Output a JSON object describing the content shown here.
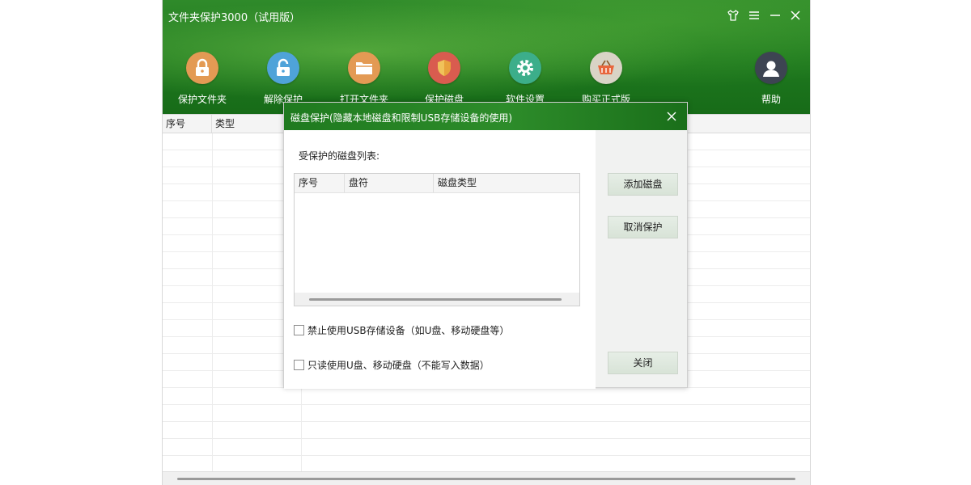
{
  "app": {
    "title": "文件夹保护3000（试用版）",
    "colors": {
      "header_green": "#1f7a1f",
      "accent_light": "#e6eee6"
    }
  },
  "window_controls": [
    {
      "name": "skin",
      "icon": "shirt-icon"
    },
    {
      "name": "menu",
      "icon": "menu-icon"
    },
    {
      "name": "minimize",
      "icon": "minimize-icon"
    },
    {
      "name": "close",
      "icon": "close-icon"
    }
  ],
  "toolbar": {
    "items": [
      {
        "label": "保护文件夹",
        "icon": "lock-icon",
        "color": "#e39a54"
      },
      {
        "label": "解除保护",
        "icon": "unlock-icon",
        "color": "#4fa3d9"
      },
      {
        "label": "打开文件夹",
        "icon": "folder-icon",
        "color": "#e39a54"
      },
      {
        "label": "保护磁盘",
        "icon": "shield-icon",
        "color": "#d95c4f"
      },
      {
        "label": "软件设置",
        "icon": "gear-icon",
        "color": "#3cae8a"
      },
      {
        "label": "购买正式版",
        "icon": "basket-icon",
        "color": "#d9d4c6"
      },
      {
        "label": "帮助",
        "icon": "user-icon",
        "color": "#3d4452"
      }
    ]
  },
  "main_table": {
    "columns": [
      "序号",
      "类型"
    ]
  },
  "dialog": {
    "title": "磁盘保护(隐藏本地磁盘和限制USB存储设备的使用)",
    "list_label": "受保护的磁盘列表:",
    "list_columns": [
      "序号",
      "盘符",
      "磁盘类型"
    ],
    "options": [
      {
        "label": "禁止使用USB存储设备（如U盘、移动硬盘等）",
        "checked": false
      },
      {
        "label": "只读使用U盘、移动硬盘（不能写入数据）",
        "checked": false
      }
    ],
    "buttons": {
      "add": "添加磁盘",
      "cancel_protect": "取消保护",
      "close": "关闭"
    }
  }
}
